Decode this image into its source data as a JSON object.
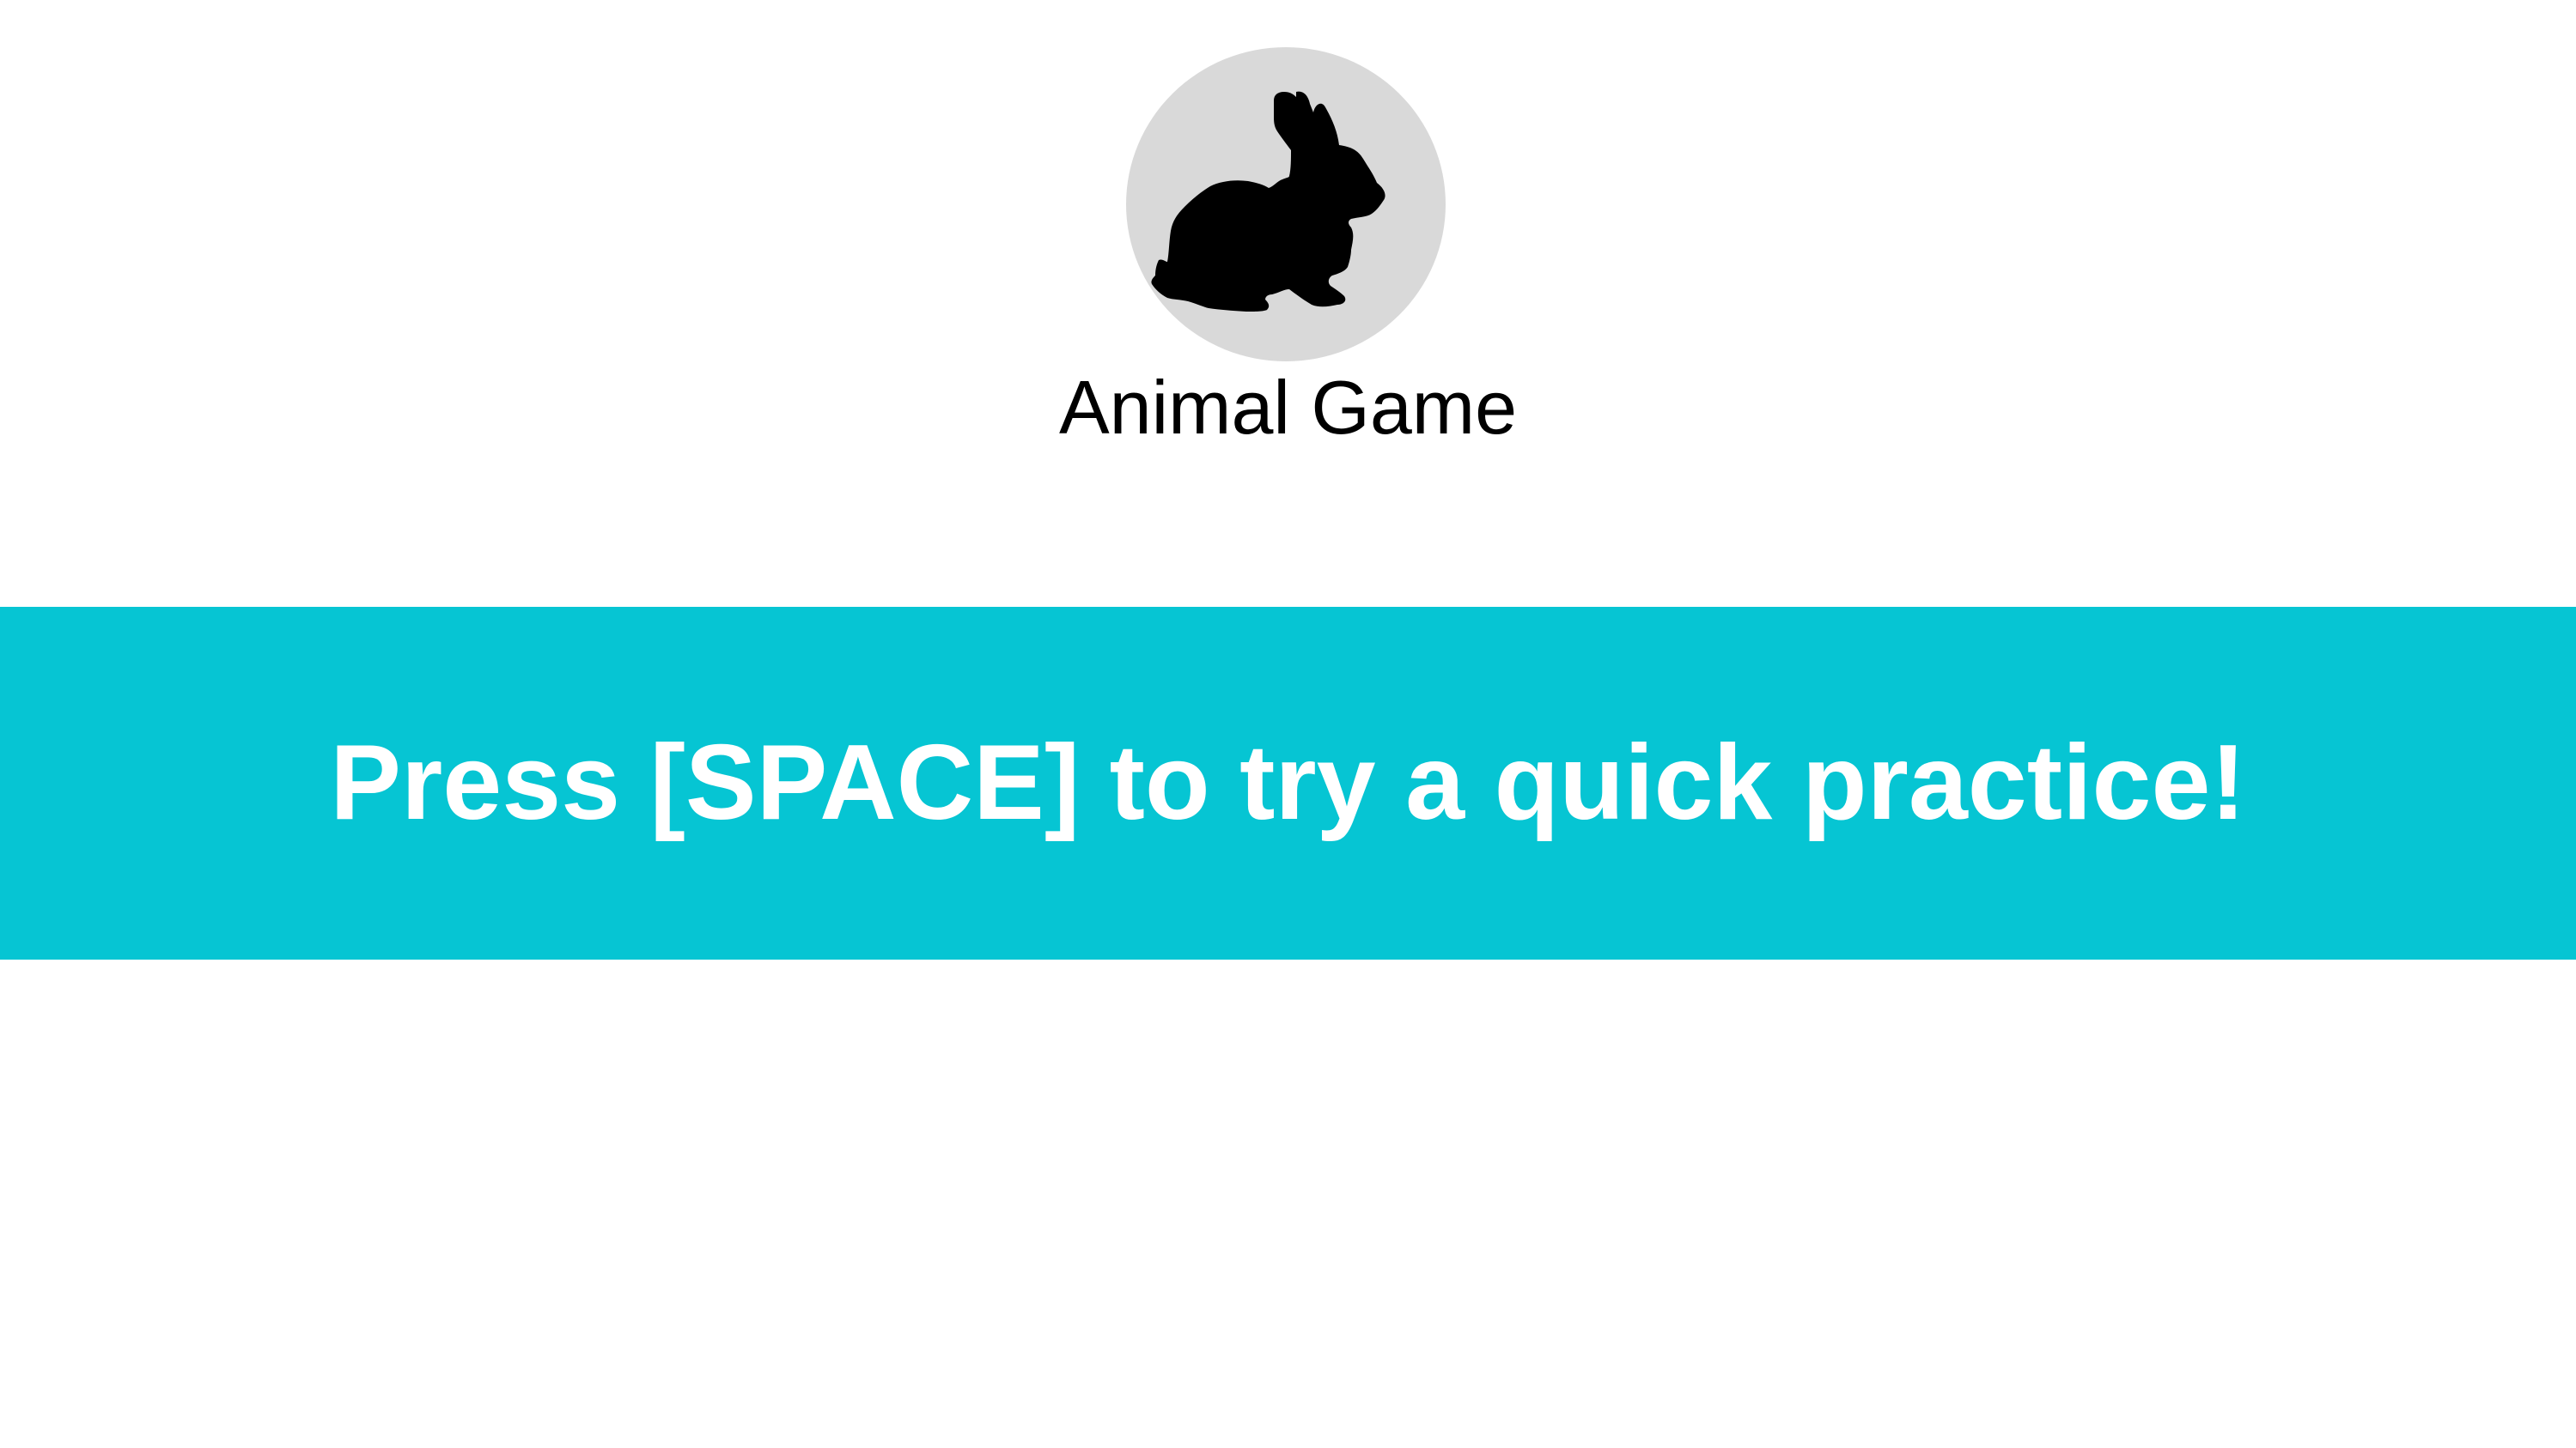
{
  "app": {
    "title": "Animal Game",
    "logo_icon": "rabbit-icon",
    "logo_background": "#d9d9d9"
  },
  "banner": {
    "text": "Press [SPACE] to try a quick practice!",
    "background": "#06c5d3",
    "text_color": "#ffffff"
  }
}
